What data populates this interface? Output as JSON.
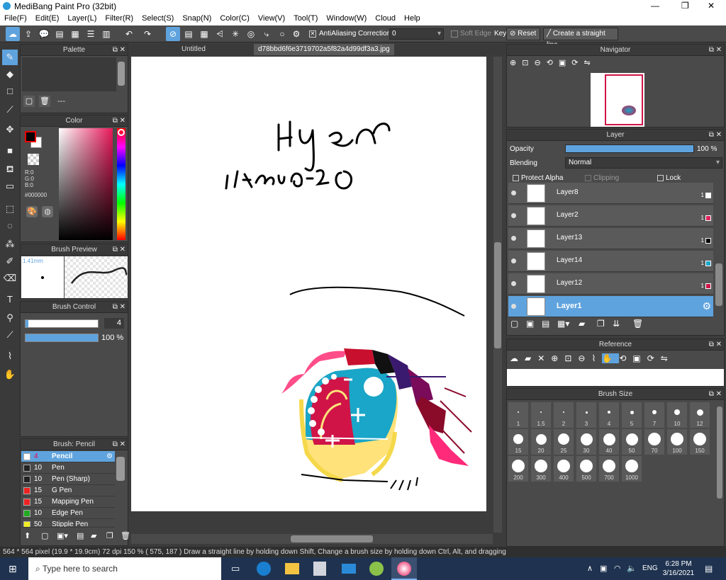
{
  "window": {
    "title": "MediBang Paint Pro (32bit)",
    "min": "—",
    "max": "❐",
    "close": "✕"
  },
  "menu": [
    "File(F)",
    "Edit(E)",
    "Layer(L)",
    "Filter(R)",
    "Select(S)",
    "Snap(N)",
    "Color(C)",
    "View(V)",
    "Tool(T)",
    "Window(W)",
    "Cloud",
    "Help"
  ],
  "toolbar": {
    "antialiasing": "AntiAliasing",
    "correction_label": "Correction",
    "correction_value": "0",
    "soft_edge": "Soft Edge",
    "key": "Key",
    "reset": "Reset",
    "straight_line": "Create a straight line"
  },
  "tabs": {
    "untitled": "Untitled",
    "file": "d78bbd6f6e3719702a5f82a4d99df3a3.jpg"
  },
  "palette": {
    "title": "Palette",
    "value": "---"
  },
  "color": {
    "title": "Color",
    "r": "R:0",
    "g": "G:0",
    "b": "B:0",
    "hex": "#000000"
  },
  "brush_preview": {
    "title": "Brush Preview",
    "size": "1.41mm"
  },
  "brush_control": {
    "title": "Brush Control",
    "size": "4",
    "opacity": "100 %"
  },
  "brush_list": {
    "title": "Brush: Pencil",
    "items": [
      {
        "n": "4",
        "label": "Pencil",
        "color": "#ffffff"
      },
      {
        "n": "10",
        "label": "Pen",
        "color": "#222222"
      },
      {
        "n": "10",
        "label": "Pen (Sharp)",
        "color": "#222222"
      },
      {
        "n": "15",
        "label": "G Pen",
        "color": "#ee2222"
      },
      {
        "n": "15",
        "label": "Mapping Pen",
        "color": "#ee2222"
      },
      {
        "n": "10",
        "label": "Edge Pen",
        "color": "#22aa22"
      },
      {
        "n": "50",
        "label": "Stipple Pen",
        "color": "#eeee22"
      }
    ]
  },
  "navigator": {
    "title": "Navigator"
  },
  "layer": {
    "title": "Layer",
    "opacity_label": "Opacity",
    "opacity_value": "100 %",
    "blending_label": "Blending",
    "blending_value": "Normal",
    "protect_alpha": "Protect Alpha",
    "clipping": "Clipping",
    "lock": "Lock",
    "items": [
      {
        "name": "Layer8",
        "color": "#ffffff",
        "num": "1"
      },
      {
        "name": "Layer2",
        "color": "#e0245e",
        "num": "1"
      },
      {
        "name": "Layer13",
        "color": "#000000",
        "num": "1"
      },
      {
        "name": "Layer14",
        "color": "#1aa6c8",
        "num": "1"
      },
      {
        "name": "Layer12",
        "color": "#d01447",
        "num": "1"
      },
      {
        "name": "Layer1",
        "color": "",
        "num": ""
      }
    ]
  },
  "reference": {
    "title": "Reference"
  },
  "brush_size": {
    "title": "Brush Size",
    "sizes": [
      "1",
      "1.5",
      "2",
      "3",
      "4",
      "5",
      "7",
      "10",
      "12",
      "15",
      "20",
      "25",
      "30",
      "40",
      "50",
      "70",
      "100",
      "150",
      "200",
      "300",
      "400",
      "500",
      "700",
      "1000"
    ]
  },
  "status": "564 * 564 pixel   (19.9 * 19.9cm)   72 dpi   150 %   ( 575, 187 )   Draw a straight line by holding down Shift, Change a brush size by holding down Ctrl, Alt, and dragging",
  "taskbar": {
    "search": "Type here to search",
    "lang": "ENG",
    "time": "6:28 PM",
    "date": "3/16/2021"
  },
  "colors": {
    "accent": "#5fa3de",
    "panel": "#4a4a4a",
    "taskbar": "#1f3350"
  }
}
